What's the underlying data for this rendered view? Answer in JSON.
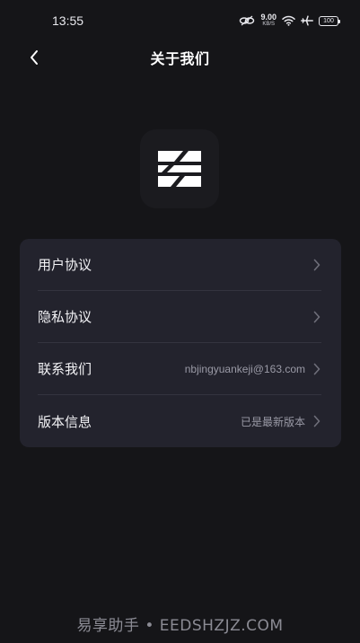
{
  "status_bar": {
    "time": "13:55",
    "net_speed_value": "9.00",
    "net_speed_unit": "KB/S",
    "battery": "100",
    "icons": [
      "link-icon",
      "wifi-icon",
      "airplane-icon",
      "battery-icon"
    ]
  },
  "header": {
    "title": "关于我们",
    "back_icon": "chevron-left-icon"
  },
  "logo": {
    "icon": "app-logo-icon"
  },
  "settings": {
    "items": [
      {
        "label": "用户协议",
        "value": ""
      },
      {
        "label": "隐私协议",
        "value": ""
      },
      {
        "label": "联系我们",
        "value": "nbjingyuankeji@163.com"
      },
      {
        "label": "版本信息",
        "value": "已是最新版本"
      }
    ]
  },
  "watermark": {
    "text": "易享助手 • EEDSHZJZ.COM"
  },
  "colors": {
    "background": "#151518",
    "card": "#23232d",
    "divider": "#34343f",
    "secondary_text": "#9a9aa6"
  }
}
